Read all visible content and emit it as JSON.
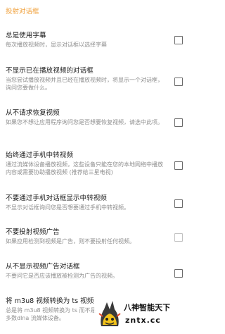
{
  "section_header": "投射对话框",
  "items": [
    {
      "title": "总是使用字幕",
      "summary": "每次播放视频时，显示对话框以选择字幕"
    },
    {
      "title": "不显示已在播放视频的对话框",
      "summary": "当您尝试播放视频并且已经在播放视频时，将显示一个对话框，询问您要做什么。"
    },
    {
      "title": "从不请求恢复视频",
      "summary": "如果您不想让应用程序询问您是否想要恢复视频，请选中此项。"
    },
    {
      "title": "始终通过手机中转视频",
      "summary": "通过流媒体设备播放视频，这些设备只能在您的本地网络中播放内容或需要协助播放视频 (推荐给三星电视)"
    },
    {
      "title": "不要通过手机对话框显示中转视频",
      "summary": "不显示对话框询问您是否想要通过手机中转视频。"
    },
    {
      "title": "不要投射视频广告",
      "summary": "如果应用检测到视频是广告，则不要投射任何视频。"
    },
    {
      "title": "从不显示视频广告对话框",
      "summary": "不要问它是否应该播放被检测为广告的视频。"
    },
    {
      "title": "将 m3u8 视频转换为 ts 视频",
      "summary": "总是将 m3u8 视频转换为 ts 而不是多数dlna 流媒体设备。"
    }
  ],
  "watermark": {
    "name": "八神智能天下",
    "domain": "zntx.cc"
  },
  "colors": {
    "header_accent": "#f0a13c",
    "title_text": "#202020",
    "summary_text": "#8e8e8e"
  }
}
